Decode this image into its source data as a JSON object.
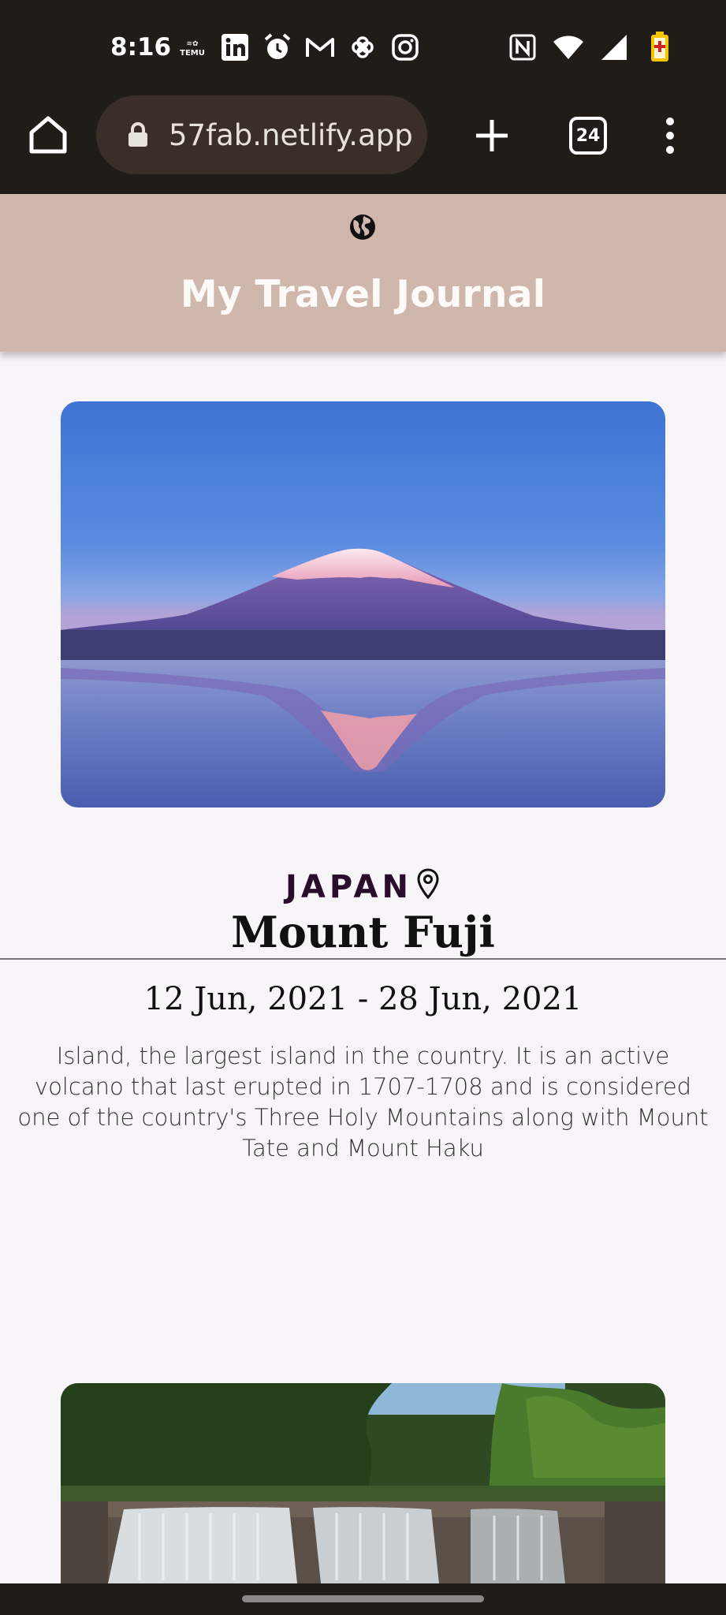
{
  "status_bar": {
    "time": "8:16",
    "left_icons": [
      "temu-icon",
      "linkedin-icon",
      "alarm-icon",
      "gmail-icon",
      "pinwheel-icon",
      "instagram-icon"
    ],
    "right_icons": [
      "nfc-icon",
      "wifi-icon",
      "signal-icon",
      "battery-icon"
    ]
  },
  "browser": {
    "url": "57fab.netlify.app",
    "tab_count": "24"
  },
  "header": {
    "title": "My Travel Journal"
  },
  "entries": [
    {
      "country": "JAPAN",
      "title": "Mount Fuji",
      "dates": "12 Jun, 2021 - 28 Jun, 2021",
      "description": "Island, the largest island in the country. It is an active volcano that last erupted in 1707-1708 and is considered one of the country's Three Holy Mountains along with Mount Tate and Mount Haku"
    }
  ],
  "colors": {
    "header_bg": "#d0b7ab",
    "page_bg": "#f7f5f7",
    "country_text": "#2a0d2c",
    "chrome_bg": "#201c18"
  }
}
